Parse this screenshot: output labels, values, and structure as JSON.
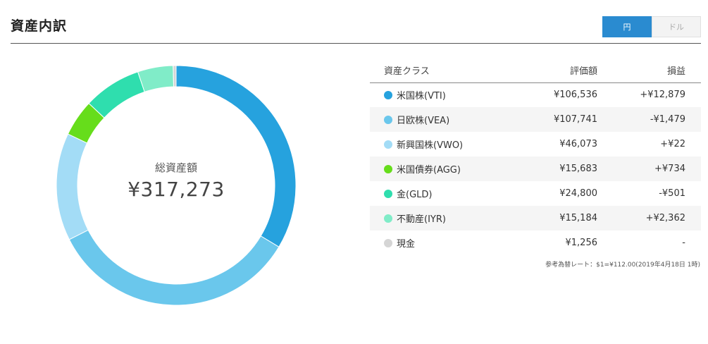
{
  "page": {
    "title": "資産内訳"
  },
  "currency_toggle": {
    "yen_label": "円",
    "dollar_label": "ドル",
    "selected": "円"
  },
  "total": {
    "label": "総資産額",
    "value": "¥317,273"
  },
  "table": {
    "headers": {
      "asset_class": "資産クラス",
      "valuation": "評価額",
      "gain_loss": "損益"
    },
    "rows": [
      {
        "name": "米国株(VTI)",
        "color": "#26a2de",
        "valuation": "¥106,536",
        "gain": "+¥12,879",
        "sign": "pos"
      },
      {
        "name": "日欧株(VEA)",
        "color": "#6ac7ec",
        "valuation": "¥107,741",
        "gain": "-¥1,479",
        "sign": "neg"
      },
      {
        "name": "新興国株(VWO)",
        "color": "#a3dcf6",
        "valuation": "¥46,073",
        "gain": "+¥22",
        "sign": "pos"
      },
      {
        "name": "米国債券(AGG)",
        "color": "#66dd1b",
        "valuation": "¥15,683",
        "gain": "+¥734",
        "sign": "pos"
      },
      {
        "name": "金(GLD)",
        "color": "#2fdeae",
        "valuation": "¥24,800",
        "gain": "-¥501",
        "sign": "neg"
      },
      {
        "name": "不動産(IYR)",
        "color": "#80ecc8",
        "valuation": "¥15,184",
        "gain": "+¥2,362",
        "sign": "pos"
      },
      {
        "name": "現金",
        "color": "#d5d5d5",
        "valuation": "¥1,256",
        "gain": "-",
        "sign": "none"
      }
    ]
  },
  "rate_note": "参考為替レート：$1=¥112.00(2019年4月18日 1時)",
  "chart_data": {
    "type": "pie",
    "title": "",
    "categories": [
      "米国株(VTI)",
      "日欧株(VEA)",
      "新興国株(VWO)",
      "米国債券(AGG)",
      "金(GLD)",
      "不動産(IYR)",
      "現金"
    ],
    "values": [
      106536,
      107741,
      46073,
      15683,
      24800,
      15184,
      1256
    ],
    "colors": [
      "#26a2de",
      "#6ac7ec",
      "#a3dcf6",
      "#66dd1b",
      "#2fdeae",
      "#80ecc8",
      "#d5d5d5"
    ],
    "style": "donut",
    "start": "top, clockwise"
  }
}
